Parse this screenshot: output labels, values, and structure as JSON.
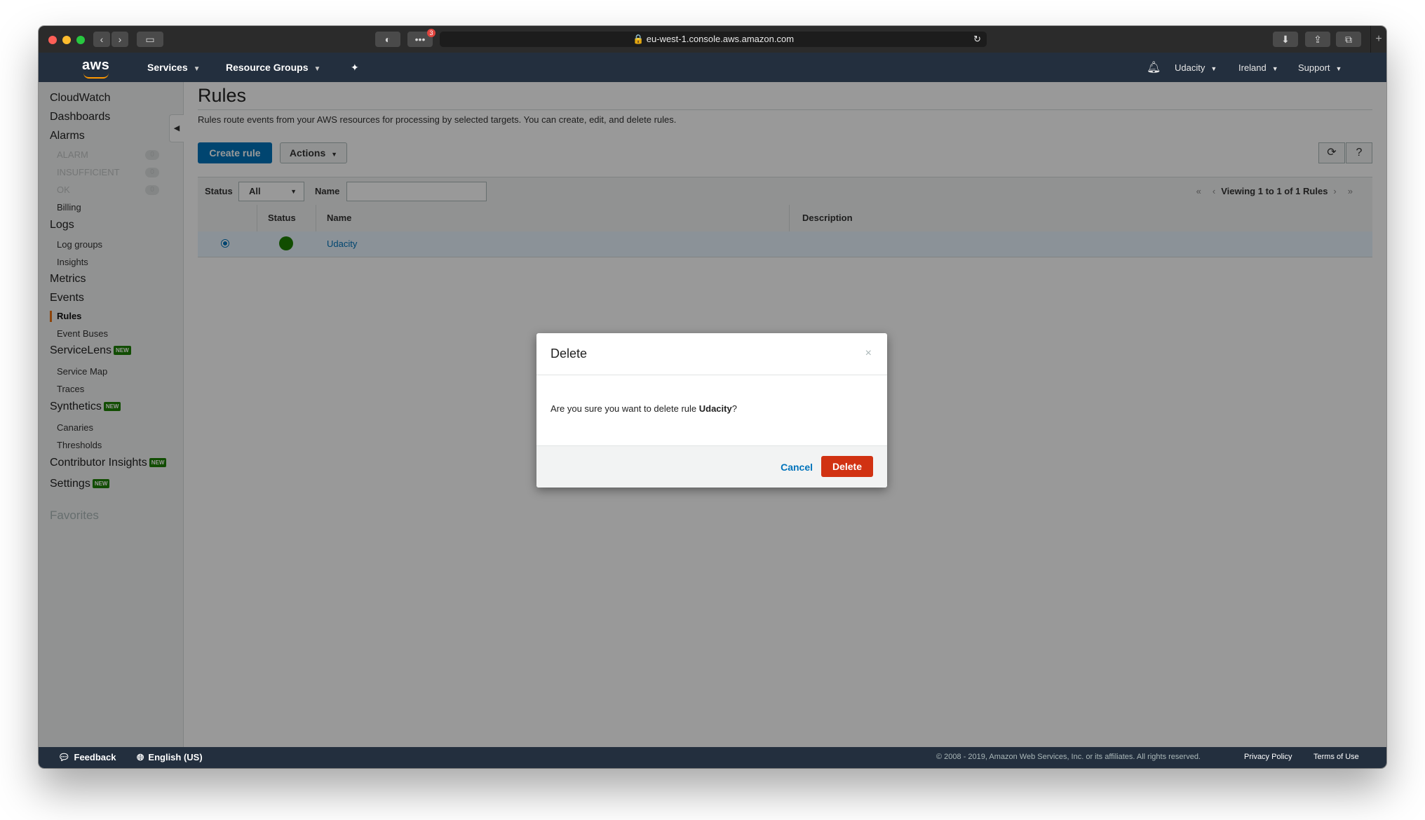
{
  "browser": {
    "url": "eu-west-1.console.aws.amazon.com",
    "extension_badge": "3",
    "new_tab": "+"
  },
  "nav": {
    "logo": "aws",
    "services": "Services",
    "resource_groups": "Resource Groups",
    "account": "Udacity",
    "region": "Ireland",
    "support": "Support"
  },
  "sidebar": {
    "cloudwatch": "CloudWatch",
    "dashboards": "Dashboards",
    "alarms": "Alarms",
    "alarm": "ALARM",
    "alarm_count": "0",
    "insufficient": "INSUFFICIENT",
    "insufficient_count": "0",
    "ok": "OK",
    "ok_count": "0",
    "billing": "Billing",
    "logs": "Logs",
    "log_groups": "Log groups",
    "insights": "Insights",
    "metrics": "Metrics",
    "events": "Events",
    "rules": "Rules",
    "event_buses": "Event Buses",
    "servicelens": "ServiceLens",
    "service_map": "Service Map",
    "traces": "Traces",
    "synthetics": "Synthetics",
    "canaries": "Canaries",
    "thresholds": "Thresholds",
    "contributor_insights": "Contributor Insights",
    "settings": "Settings",
    "new_badge": "NEW",
    "favorites": "Favorites"
  },
  "page": {
    "title": "Rules",
    "description": "Rules route events from your AWS resources for processing by selected targets. You can create, edit, and delete rules.",
    "create_rule": "Create rule",
    "actions": "Actions",
    "filter_status_label": "Status",
    "filter_status_value": "All",
    "filter_name_label": "Name",
    "pager_text": "Viewing 1 to 1 of 1 Rules"
  },
  "table": {
    "headers": [
      "Status",
      "Name",
      "Description"
    ],
    "rows": [
      {
        "name": "Udacity",
        "description": "",
        "status_color": "#1d8102",
        "selected": true
      }
    ]
  },
  "modal": {
    "title": "Delete",
    "close": "×",
    "message_prefix": "Are you sure you want to delete rule ",
    "rule_name": "Udacity",
    "message_suffix": "?",
    "cancel": "Cancel",
    "confirm": "Delete"
  },
  "footer": {
    "feedback": "Feedback",
    "language": "English (US)",
    "copyright": "© 2008 - 2019, Amazon Web Services, Inc. or its affiliates. All rights reserved.",
    "privacy": "Privacy Policy",
    "terms": "Terms of Use"
  },
  "colors": {
    "nav_bg": "#232f3e",
    "primary": "#0073bb",
    "danger": "#d13212",
    "accent": "#ec7211",
    "success": "#1d8102"
  }
}
